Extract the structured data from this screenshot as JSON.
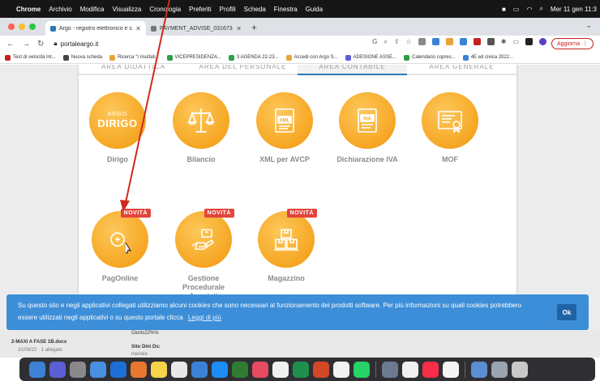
{
  "menubar": {
    "apple": "",
    "items": [
      "Chrome",
      "Archivio",
      "Modifica",
      "Visualizza",
      "Cronologia",
      "Preferiti",
      "Profili",
      "Scheda",
      "Finestra",
      "Guida"
    ],
    "clock": "Mer 11 gen 11:3"
  },
  "tabs": [
    {
      "title": "Argo - registro elettronico e si",
      "color": "#2d76b4"
    },
    {
      "title": "PAYMENT_ADVISE_0316734",
      "color": "#555555"
    }
  ],
  "toolbar": {
    "url": "portaleargo.it",
    "update_label": "Aggiorna"
  },
  "bookmarks": [
    {
      "label": "Test di velocità Int...",
      "color": "#c5221f"
    },
    {
      "label": "Nuova scheda",
      "color": "#444444"
    },
    {
      "label": "Ricerca \"I risultati...",
      "color": "#e8a33a"
    },
    {
      "label": "VICEPRESIDENZA...",
      "color": "#2f9e44"
    },
    {
      "label": "3 AGENDA 22-23...",
      "color": "#2f9e44"
    },
    {
      "label": "Accedi con Argo S...",
      "color": "#e8a33a"
    },
    {
      "label": "ADESIONE ASSE...",
      "color": "#5a5fd6"
    },
    {
      "label": "Calendario copres...",
      "color": "#2f9e44"
    },
    {
      "label": "4E ed civica 2022...",
      "color": "#3b82d6"
    }
  ],
  "area_tabs": [
    "AREA DIDATTICA",
    "AREA DEL PERSONALE",
    "AREA CONTABILE",
    "AREA GENERALE"
  ],
  "apps": {
    "dirigo": {
      "label": "Dirigo",
      "logo_top": "ARGO",
      "logo_main": "DIRIGO"
    },
    "bilancio": {
      "label": "Bilancio"
    },
    "xml": {
      "label": "XML per AVCP",
      "icon_text": "XML"
    },
    "iva": {
      "label": "Dichiarazione IVA",
      "icon_text": "IVA"
    },
    "mof": {
      "label": "MOF"
    },
    "pagonline": {
      "label": "PagOnline",
      "badge": "NOVITÀ"
    },
    "gestione": {
      "label": "Gestione Procedurale Acquisti",
      "badge": "NOVITÀ"
    },
    "magazzino": {
      "label": "Magazzino",
      "badge": "NOVITÀ"
    }
  },
  "cookie": {
    "text": "Su questo sito e negli applicativi collegati utilizziamo alcuni cookies che sono necessari al funzionamento dei prodotti software. Per più informazioni su quali cookies potrebbero essere utilizzati negli applicativi o su questo portale clicca",
    "link": "Leggi di più",
    "ok": "Ok"
  },
  "files": {
    "name": "2-MAXI A FASE 1B.docx",
    "sub": "31/08/22 · 1 allegato",
    "col1": "Giorto22%%",
    "col2": "Sito Dini Ds:",
    "col3": "mariala"
  },
  "colors": {
    "accent": "#f6a623",
    "badge": "#e2453c",
    "cookie": "#3c8ed8"
  }
}
